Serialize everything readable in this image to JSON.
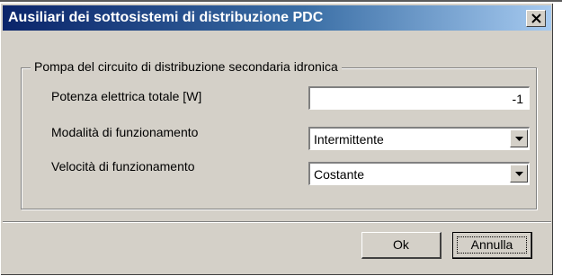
{
  "window": {
    "title": "Ausiliari dei sottosistemi di distribuzione PDC"
  },
  "group": {
    "legend": "Pompa del circuito di distribuzione secondaria idronica"
  },
  "fields": {
    "power_label": "Potenza elettrica totale [W]",
    "power_value": "-1",
    "mode_label": "Modalità di funzionamento",
    "mode_value": "Intermittente",
    "speed_label": "Velocità di funzionamento",
    "speed_value": "Costante"
  },
  "buttons": {
    "ok_label": "Ok",
    "cancel_label": "Annulla"
  },
  "icons": {
    "close": "close-icon",
    "dropdown": "chevron-down-icon"
  },
  "colors": {
    "titlebar_start": "#0a246a",
    "titlebar_end": "#a6caf0",
    "dialog_face": "#d4d0c8"
  }
}
